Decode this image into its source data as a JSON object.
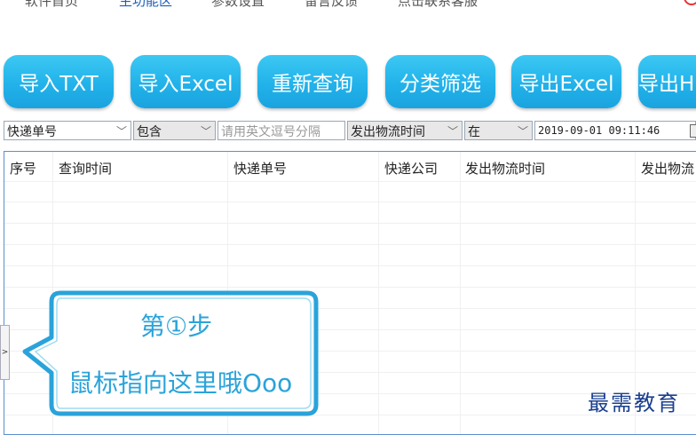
{
  "menu": {
    "items": [
      "软件首页",
      "主功能区",
      "参数设置",
      "留言反馈",
      "点击联系客服"
    ]
  },
  "toolbar": {
    "buttons": [
      "导入TXT",
      "导入Excel",
      "重新查询",
      "分类筛选",
      "导出Excel",
      "导出H"
    ]
  },
  "filters": {
    "field1": "快递单号",
    "op1": "包含",
    "input_placeholder": "请用英文逗号分隔",
    "field2": "发出物流时间",
    "op2": "在",
    "datetime": "2019-09-01 09:11:46"
  },
  "table": {
    "columns": [
      "序号",
      "查询时间",
      "快递单号",
      "快递公司",
      "发出物流时间",
      "发出物流"
    ]
  },
  "callout": {
    "step": "第①步",
    "hint": "鼠标指向这里哦Ooo"
  },
  "side_tab": ">",
  "watermark": "最需教育",
  "colors": {
    "button_blue": "#22b2ea",
    "callout_blue": "#2aa3da",
    "menu_active": "#1f5fb8"
  }
}
